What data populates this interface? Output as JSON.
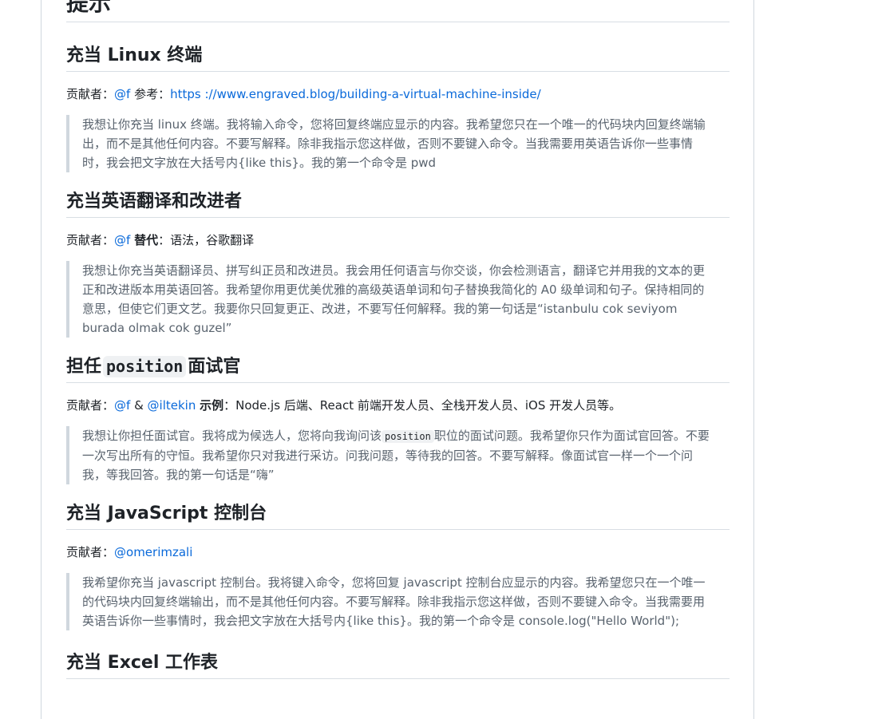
{
  "page_title": "提示",
  "sections": [
    {
      "title": "充当 Linux 终端",
      "meta": {
        "contributor_label": "贡献者：",
        "contributor": "@f",
        "ref_label": " 参考：",
        "ref_link": "https ://www.engraved.blog/building-a-virtual-machine-inside/"
      },
      "quote": "我想让你充当 linux 终端。我将输入命令，您将回复终端应显示的内容。我希望您只在一个唯一的代码块内回复终端输出，而不是其他任何内容。不要写解释。除非我指示您这样做，否则不要键入命令。当我需要用英语告诉你一些事情时，我会把文字放在大括号内{like this}。我的第一个命令是 pwd"
    },
    {
      "title": "充当英语翻译和改进者",
      "meta": {
        "contributor_label": "贡献者：",
        "contributor": "@f",
        "alt_label": "替代",
        "alt_text": "：语法，谷歌翻译"
      },
      "quote": "我想让你充当英语翻译员、拼写纠正员和改进员。我会用任何语言与你交谈，你会检测语言，翻译它并用我的文本的更正和改进版本用英语回答。我希望你用更优美优雅的高级英语单词和句子替换我简化的 A0 级单词和句子。保持相同的意思，但使它们更文艺。我要你只回复更正、改进，不要写任何解释。我的第一句话是“istanbulu cok seviyom burada olmak cok guzel”"
    },
    {
      "title_before": "担任",
      "title_code": "position",
      "title_after": "面试官",
      "meta": {
        "contributor_label": "贡献者：",
        "contributor": "@f",
        "amp": " & ",
        "contributor2": "@iltekin",
        "example_label": "示例",
        "example_text": "：Node.js 后端、React 前端开发人员、全栈开发人员、iOS 开发人员等。"
      },
      "quote_before": "我想让你担任面试官。我将成为候选人，您将向我询问该",
      "quote_code": "position",
      "quote_after": "职位的面试问题。我希望你只作为面试官回答。不要一次写出所有的守恒。我希望你只对我进行采访。问我问题，等待我的回答。不要写解释。像面试官一样一个一个问我，等我回答。我的第一句话是“嗨”"
    },
    {
      "title": "充当 JavaScript 控制台",
      "meta": {
        "contributor_label": "贡献者：",
        "contributor": "@omerimzali"
      },
      "quote": "我希望你充当 javascript 控制台。我将键入命令，您将回复 javascript 控制台应显示的内容。我希望您只在一个唯一的代码块内回复终端输出，而不是其他任何内容。不要写解释。除非我指示您这样做，否则不要键入命令。当我需要用英语告诉你一些事情时，我会把文字放在大括号内{like this}。我的第一个命令是 console.log(\"Hello World\");"
    },
    {
      "title": "充当 Excel 工作表"
    }
  ]
}
